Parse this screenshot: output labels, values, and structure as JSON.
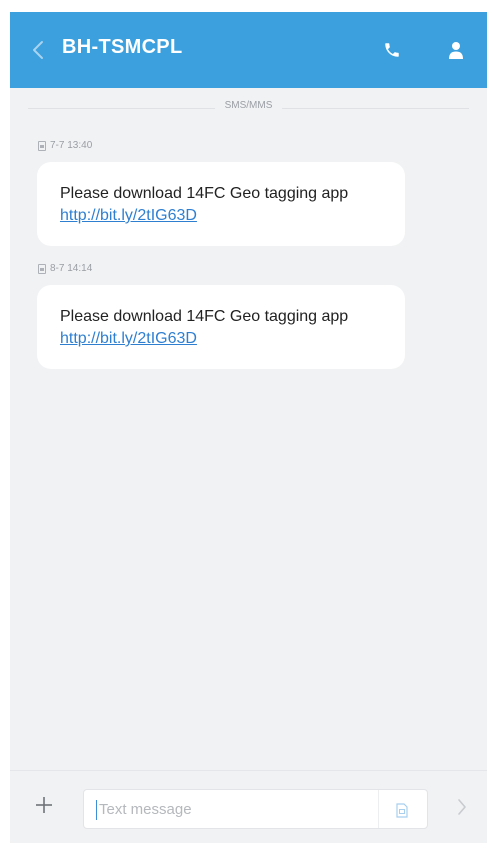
{
  "header": {
    "contact_name": "BH-TSMCPL",
    "accent_color": "#3ba0dd",
    "back_icon": "chevron-left-icon",
    "call_icon": "phone-icon",
    "contact_icon": "person-icon"
  },
  "conversation": {
    "channel_label": "SMS/MMS",
    "messages": [
      {
        "timestamp": "7-7 13:40",
        "text": "Please download 14FC Geo tagging app",
        "link": "http://bit.ly/2tIG63D"
      },
      {
        "timestamp": "8-7 14:14",
        "text": "Please download 14FC Geo tagging app",
        "link": "http://bit.ly/2tIG63D"
      }
    ]
  },
  "composer": {
    "add_icon": "plus-icon",
    "placeholder": "Text message",
    "attach_icon": "sim-icon",
    "send_icon": "chevron-right-icon"
  }
}
